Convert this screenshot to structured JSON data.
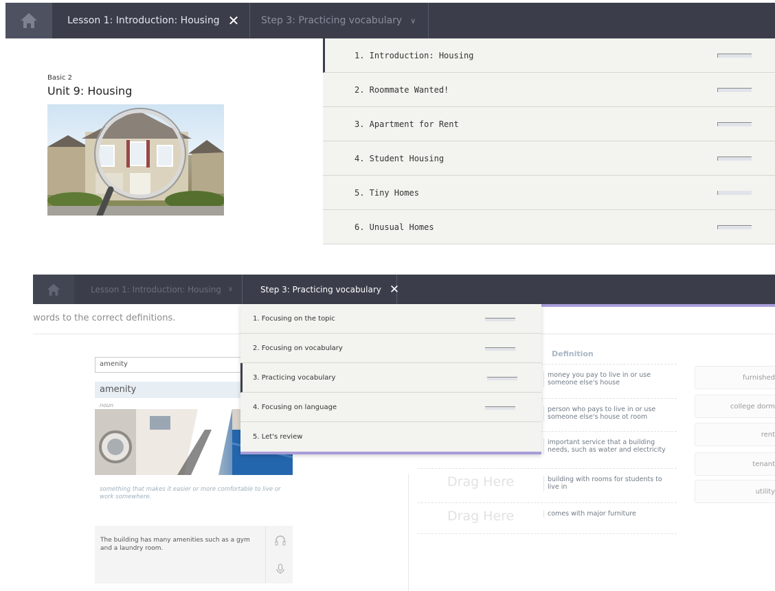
{
  "top": {
    "nav": {
      "lesson_tab": "Lesson 1: Introduction: Housing",
      "step_tab": "Step 3: Practicing vocabulary"
    },
    "unit": {
      "level": "Basic 2",
      "title": "Unit 9: Housing"
    },
    "lessons": [
      {
        "label": "1. Introduction: Housing",
        "progress": 0.0
      },
      {
        "label": "2. Roommate Wanted!",
        "progress": 0.0
      },
      {
        "label": "3. Apartment for Rent",
        "progress": 0.0
      },
      {
        "label": "4. Student Housing",
        "progress": 0.0
      },
      {
        "label": "5. Tiny Homes",
        "progress": 0.0
      },
      {
        "label": "6. Unusual Homes",
        "progress": 0.0
      }
    ]
  },
  "bottom": {
    "nav": {
      "lesson_tab": "Lesson 1: Introduction: Housing",
      "step_tab": "Step 3: Practicing vocabulary"
    },
    "instructions": "e words to the correct definitions.",
    "steps": [
      {
        "label": "1. Focusing on the topic"
      },
      {
        "label": "2. Focusing on vocabulary"
      },
      {
        "label": "3. Practicing vocabulary"
      },
      {
        "label": "4. Focusing on language"
      },
      {
        "label": "5. Let's review"
      }
    ],
    "dictionary": {
      "search_value": "amenity",
      "word": "amenity",
      "part_of_speech": "noun",
      "definition": "something that makes it easier or more comfortable to live or work somewhere.",
      "example": "The building has many amenities such as a gym and a laundry room."
    },
    "definition_header": "Definition",
    "definitions": [
      {
        "drag": "",
        "text": "money you pay to live in or use someone else's house"
      },
      {
        "drag": "",
        "text": "person who pays to live in or use someone else's house ot room"
      },
      {
        "drag": "",
        "text": "important service that a building needs, such as water and electricity"
      },
      {
        "drag": "Drag Here",
        "text": "building with rooms for students to live in"
      },
      {
        "drag": "Drag Here",
        "text": "comes with major furniture"
      }
    ],
    "words": [
      "furnished",
      "college dorm",
      "rent",
      "tenant",
      "utility"
    ]
  }
}
